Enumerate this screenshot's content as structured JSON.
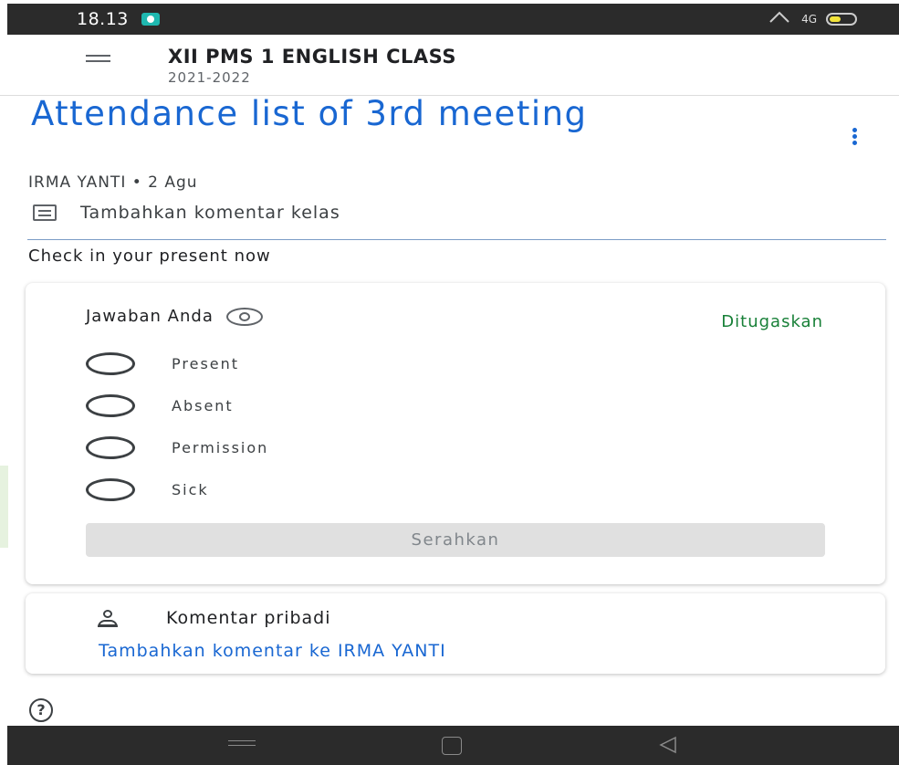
{
  "status_bar": {
    "time": "18.13",
    "network": "4G"
  },
  "app_bar": {
    "class_name": "XII PMS 1 ENGLISH CLASS",
    "class_year": "2021-2022"
  },
  "assignment": {
    "title": "Attendance list of 3rd meeting",
    "author_date": "IRMA YANTI • 2 Agu",
    "class_comment_label": "Tambahkan komentar kelas",
    "instructions": "Check in your present now"
  },
  "answer_card": {
    "heading": "Jawaban Anda",
    "status": "Ditugaskan",
    "options": [
      "Present",
      "Absent",
      "Permission",
      "Sick"
    ],
    "submit_label": "Serahkan"
  },
  "private_comments": {
    "title": "Komentar pribadi",
    "add_link": "Tambahkan komentar ke IRMA YANTI"
  },
  "colors": {
    "accent_blue": "#1967d2",
    "status_green": "#188038"
  }
}
